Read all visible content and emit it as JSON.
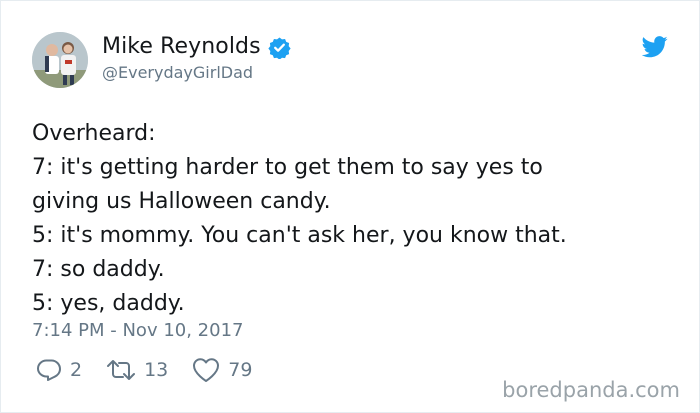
{
  "user": {
    "display_name": "Mike Reynolds",
    "handle": "@EverydayGirlDad",
    "verified": true
  },
  "tweet": {
    "lines": [
      "Overheard:",
      "7: it's getting harder to get them to say yes to",
      "giving us Halloween candy.",
      "5: it's mommy. You can't ask her, you know that.",
      "7: so daddy.",
      "5: yes, daddy."
    ],
    "timestamp": "7:14 PM - Nov 10, 2017"
  },
  "actions": {
    "reply_count": "2",
    "retweet_count": "13",
    "like_count": "79"
  },
  "icons": {
    "brand": "twitter-bird-icon",
    "verified": "verified-badge-icon",
    "reply": "reply-icon",
    "retweet": "retweet-icon",
    "like": "heart-icon"
  },
  "colors": {
    "twitter_blue": "#1da1f2",
    "text": "#14171a",
    "secondary_text": "#657786",
    "watermark": "#9aa3a9"
  },
  "watermark": "boredpanda.com"
}
